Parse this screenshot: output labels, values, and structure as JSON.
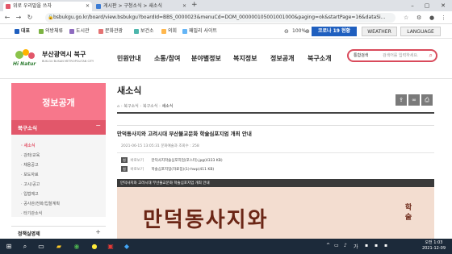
{
  "browser": {
    "tabs": [
      {
        "label": "위로 우리말을 쓰자"
      },
      {
        "label": "게시판 > 구청소식 > 새소식"
      }
    ],
    "url": "bsbukgu.go.kr/board/view.bsbukgu?boardId=BBS_0000023&menuCd=DOM_000000105001001000&paging=ok&startPage=16&dataSi...",
    "bookmarks": [
      "대표",
      "의방체류",
      "도시관",
      "문화관광",
      "보건소",
      "의회",
      "패밀리 사이트"
    ],
    "zoom": "100%",
    "corona_button": "코로나 19 현황",
    "weather_button": "WEATHER",
    "language_button": "LANGUAGE"
  },
  "site": {
    "logo_text": "부산광역시 북구",
    "logo_sub": "BUK-GU BUSAN METROPOLITAN CITY",
    "logo_mark": "Hi Natur",
    "gnb": [
      "민원안내",
      "소통/참여",
      "분야별정보",
      "복지정보",
      "정보공개",
      "북구소개"
    ],
    "search": {
      "select": "통합검색",
      "placeholder": "검색어를 입력하세요."
    }
  },
  "sidebar": {
    "hero": "정보공개",
    "section": "북구소식",
    "items": [
      "새소식",
      "강좌/교육",
      "채용공고",
      "보도자료",
      "고시/공고",
      "입법예고",
      "공사관/전화/입찰계획",
      "타기관소식"
    ],
    "active_index": 0,
    "next_section": "정책실명제"
  },
  "content": {
    "title": "새소식",
    "breadcrumb": [
      "북구소식",
      "북구소식",
      "새소식"
    ],
    "post_title": "만덕동사지와 고려시대 부산불교문화 학술심포지엄 개최 안내",
    "post_meta": "2021-06-15 13:05:31   문화예술과   조회수 : 258",
    "files": [
      {
        "badge": "첨",
        "download": "바로보기",
        "name": "만덕사지학술심포지엄(포스터).jpg(4333 KB)"
      },
      {
        "badge": "첨",
        "download": "바로보기",
        "name": "학술심포지엄(자료집)(1)-hwp(411 KB)"
      }
    ],
    "poster_header": "만덕사지와 고려시대 부산불교문화 학술심포지엄 개최 안내",
    "poster_big_text": "만덕동사지와",
    "poster_side_text": "학술"
  },
  "taskbar": {
    "time": "오전 1:03",
    "date": "2021-12-09"
  },
  "colors": {
    "accent": "#e2576a",
    "hero": "#f7778b",
    "corona": "#1f5fbf",
    "taskbar": "#1c2a3a"
  }
}
